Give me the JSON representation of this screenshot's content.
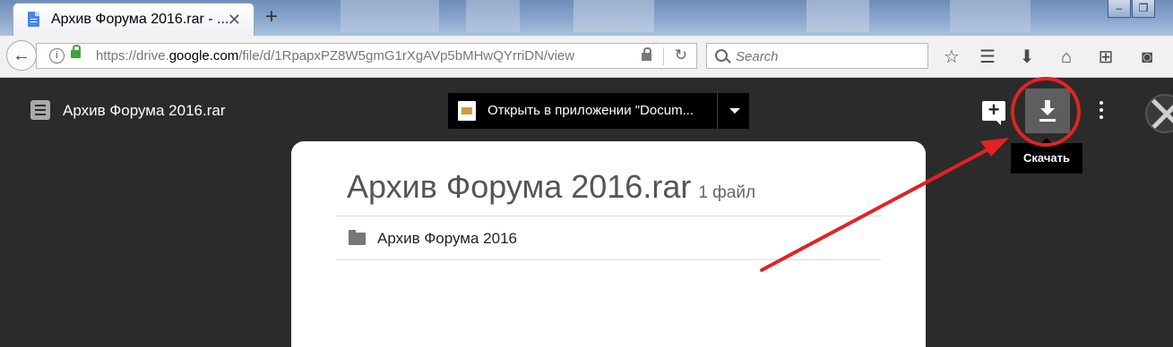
{
  "browser": {
    "tab_title": "Архив Форума 2016.rar - ...",
    "tab_close": "✕",
    "new_tab": "+",
    "url_prefix": "https://drive.",
    "url_domain": "google.com",
    "url_path": "/file/d/1RpapxPZ8W5gmG1rXgAVp5bMHwQYrriDN/view",
    "search_placeholder": "Search",
    "window_controls": {
      "minimize": "–",
      "maximize": "❐"
    }
  },
  "viewer": {
    "file_title": "Архив Форума 2016.rar",
    "open_with_label": "Открыть в приложении \"Docum...",
    "download_tooltip": "Скачать"
  },
  "archive": {
    "title": "Архив Форума 2016.rar",
    "file_count": "1 файл",
    "items": [
      {
        "name": "Архив Форума 2016",
        "icon": "folder-icon"
      }
    ]
  },
  "annotation": {
    "color": "#e32222"
  }
}
